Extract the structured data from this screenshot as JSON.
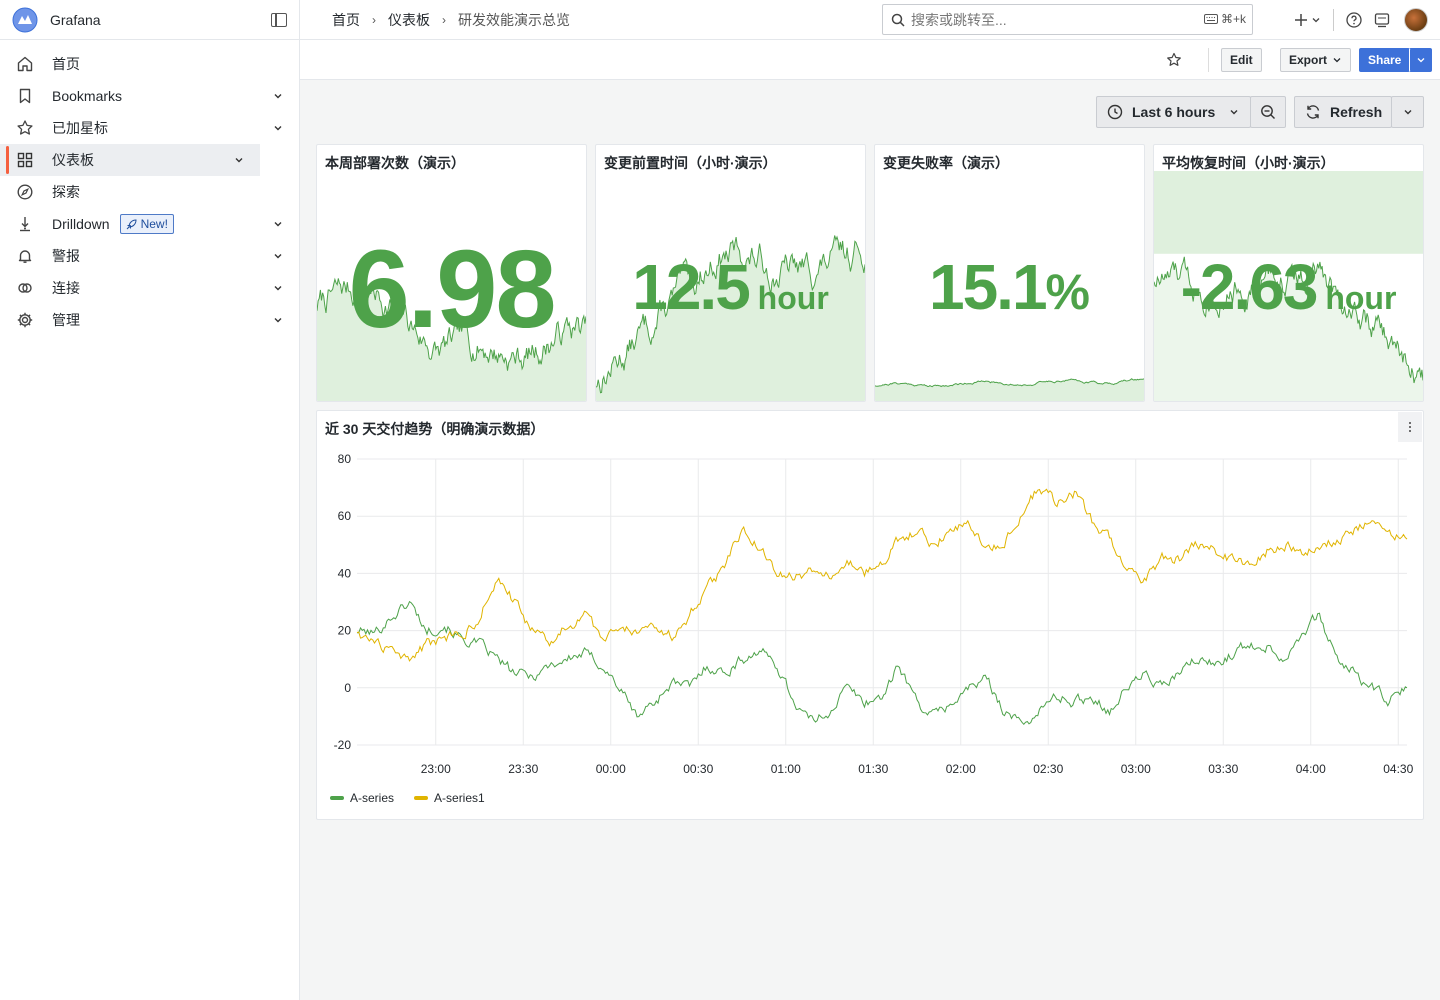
{
  "app": {
    "brand": "Grafana"
  },
  "sidebar": {
    "items": [
      {
        "label": "首页",
        "icon": "home-icon",
        "chevron": false,
        "active": false
      },
      {
        "label": "Bookmarks",
        "icon": "bookmark-icon",
        "chevron": true,
        "active": false
      },
      {
        "label": "已加星标",
        "icon": "star-icon",
        "chevron": true,
        "active": false
      },
      {
        "label": "仪表板",
        "icon": "apps-icon",
        "chevron": true,
        "active": true
      },
      {
        "label": "探索",
        "icon": "compass-icon",
        "chevron": false,
        "active": false
      },
      {
        "label": "Drilldown",
        "icon": "drilldown-icon",
        "chevron": true,
        "active": false,
        "badge": "New!"
      },
      {
        "label": "警报",
        "icon": "bell-icon",
        "chevron": true,
        "active": false
      },
      {
        "label": "连接",
        "icon": "link-icon",
        "chevron": true,
        "active": false
      },
      {
        "label": "管理",
        "icon": "cog-icon",
        "chevron": true,
        "active": false
      }
    ]
  },
  "topbar": {
    "breadcrumbs": [
      "首页",
      "仪表板",
      "研发效能演示总览"
    ],
    "search_placeholder": "搜索或跳转至...",
    "search_shortcut": "⌘+k"
  },
  "toolbar": {
    "edit": "Edit",
    "export": "Export",
    "share": "Share"
  },
  "time": {
    "range": "Last 6 hours",
    "refresh": "Refresh"
  },
  "colors": {
    "green": "#4ea24a",
    "green_fill": "#dff0dd",
    "yellow": "#e0b400",
    "accent": "#3d71d9"
  },
  "stats": [
    {
      "title": "本周部署次数（演示）",
      "value": "6.98",
      "unit": "",
      "seed": 7
    },
    {
      "title": "变更前置时间（小时·演示）",
      "value": "12.5",
      "unit": " hour",
      "seed": 13
    },
    {
      "title": "变更失败率（演示）",
      "value": "15.1",
      "unit": "%",
      "seed": 21
    },
    {
      "title": "平均恢复时间（小时·演示）",
      "value": "-2.63",
      "unit": " hour",
      "seed": 33
    }
  ],
  "chart_data": {
    "type": "line",
    "title": "近 30 天交付趋势（明确演示数据）",
    "xlabel": "",
    "ylabel": "",
    "ylim": [
      -20,
      80
    ],
    "yticks": [
      -20,
      0,
      20,
      40,
      60,
      80
    ],
    "x_ticks": [
      "23:00",
      "23:30",
      "00:00",
      "00:30",
      "01:00",
      "01:30",
      "02:00",
      "02:30",
      "03:00",
      "03:30",
      "04:00",
      "04:30"
    ],
    "x_range": [
      "22:33",
      "04:33"
    ],
    "grid": true,
    "legend": "bottom-left",
    "series": [
      {
        "name": "A-series",
        "color": "#4ea24a",
        "anchors": [
          [
            0,
            20
          ],
          [
            5,
            19
          ],
          [
            10,
            25
          ],
          [
            15,
            30
          ],
          [
            20,
            20
          ],
          [
            25,
            22
          ],
          [
            30,
            17
          ],
          [
            35,
            15
          ],
          [
            40,
            10
          ],
          [
            45,
            5
          ],
          [
            50,
            4
          ],
          [
            55,
            8
          ],
          [
            60,
            10
          ],
          [
            65,
            12
          ],
          [
            70,
            8
          ],
          [
            75,
            0
          ],
          [
            80,
            -10
          ],
          [
            85,
            -5
          ],
          [
            90,
            2
          ],
          [
            95,
            0
          ],
          [
            100,
            8
          ],
          [
            105,
            5
          ],
          [
            110,
            10
          ],
          [
            115,
            13
          ],
          [
            120,
            8
          ],
          [
            125,
            -5
          ],
          [
            130,
            -12
          ],
          [
            135,
            -8
          ],
          [
            140,
            0
          ],
          [
            145,
            -5
          ],
          [
            150,
            -3
          ],
          [
            155,
            8
          ],
          [
            160,
            -5
          ],
          [
            165,
            -10
          ],
          [
            170,
            -5
          ],
          [
            175,
            0
          ],
          [
            180,
            3
          ],
          [
            185,
            -8
          ],
          [
            190,
            -13
          ],
          [
            195,
            -8
          ],
          [
            200,
            -3
          ],
          [
            205,
            -5
          ],
          [
            210,
            -3
          ],
          [
            215,
            -8
          ],
          [
            220,
            0
          ],
          [
            225,
            5
          ],
          [
            230,
            0
          ],
          [
            235,
            5
          ],
          [
            240,
            10
          ],
          [
            245,
            8
          ],
          [
            250,
            12
          ],
          [
            255,
            15
          ],
          [
            260,
            15
          ],
          [
            265,
            10
          ],
          [
            270,
            20
          ],
          [
            275,
            25
          ],
          [
            280,
            10
          ],
          [
            285,
            5
          ],
          [
            290,
            0
          ],
          [
            295,
            -5
          ],
          [
            300,
            0
          ]
        ]
      },
      {
        "name": "A-series1",
        "color": "#e0b400",
        "anchors": [
          [
            0,
            20
          ],
          [
            5,
            15
          ],
          [
            10,
            13
          ],
          [
            15,
            10
          ],
          [
            20,
            15
          ],
          [
            25,
            18
          ],
          [
            30,
            18
          ],
          [
            35,
            25
          ],
          [
            40,
            38
          ],
          [
            45,
            30
          ],
          [
            50,
            20
          ],
          [
            55,
            15
          ],
          [
            60,
            22
          ],
          [
            65,
            25
          ],
          [
            70,
            18
          ],
          [
            75,
            22
          ],
          [
            80,
            20
          ],
          [
            85,
            22
          ],
          [
            90,
            18
          ],
          [
            95,
            25
          ],
          [
            100,
            35
          ],
          [
            105,
            42
          ],
          [
            110,
            55
          ],
          [
            115,
            50
          ],
          [
            120,
            40
          ],
          [
            125,
            38
          ],
          [
            130,
            42
          ],
          [
            135,
            40
          ],
          [
            140,
            45
          ],
          [
            145,
            40
          ],
          [
            150,
            43
          ],
          [
            155,
            52
          ],
          [
            160,
            55
          ],
          [
            165,
            50
          ],
          [
            170,
            55
          ],
          [
            175,
            58
          ],
          [
            180,
            48
          ],
          [
            185,
            52
          ],
          [
            190,
            62
          ],
          [
            195,
            70
          ],
          [
            200,
            65
          ],
          [
            205,
            68
          ],
          [
            210,
            58
          ],
          [
            215,
            52
          ],
          [
            220,
            42
          ],
          [
            225,
            38
          ],
          [
            230,
            45
          ],
          [
            235,
            45
          ],
          [
            240,
            50
          ],
          [
            245,
            48
          ],
          [
            250,
            45
          ],
          [
            255,
            42
          ],
          [
            260,
            48
          ],
          [
            265,
            50
          ],
          [
            270,
            48
          ],
          [
            275,
            50
          ],
          [
            280,
            52
          ],
          [
            285,
            55
          ],
          [
            290,
            58
          ],
          [
            295,
            55
          ],
          [
            300,
            52
          ]
        ]
      }
    ]
  }
}
